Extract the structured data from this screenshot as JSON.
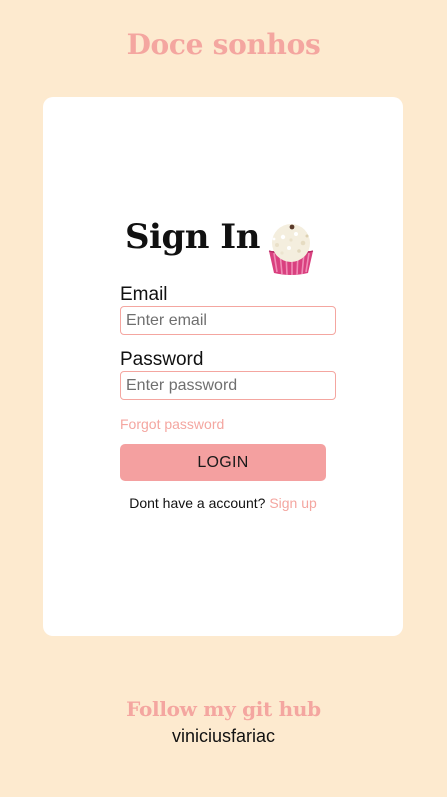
{
  "header": {
    "title": "Doce sonhos"
  },
  "signin": {
    "heading": "Sign In",
    "icon": "brigadeiro-cupcake-icon",
    "email_label": "Email",
    "email_placeholder": "Enter email",
    "email_value": "",
    "password_label": "Password",
    "password_placeholder": "Enter password",
    "password_value": "",
    "forgot_label": "Forgot password",
    "login_label": "LOGIN",
    "no_account_text": "Dont have a account?",
    "signup_label": "Sign up"
  },
  "footer": {
    "title": "Follow my git hub",
    "handle": "viniciusfariac"
  },
  "colors": {
    "background": "#fdeacf",
    "accent": "#f4a6a0",
    "button": "#f4a0a0",
    "card": "#ffffff"
  }
}
